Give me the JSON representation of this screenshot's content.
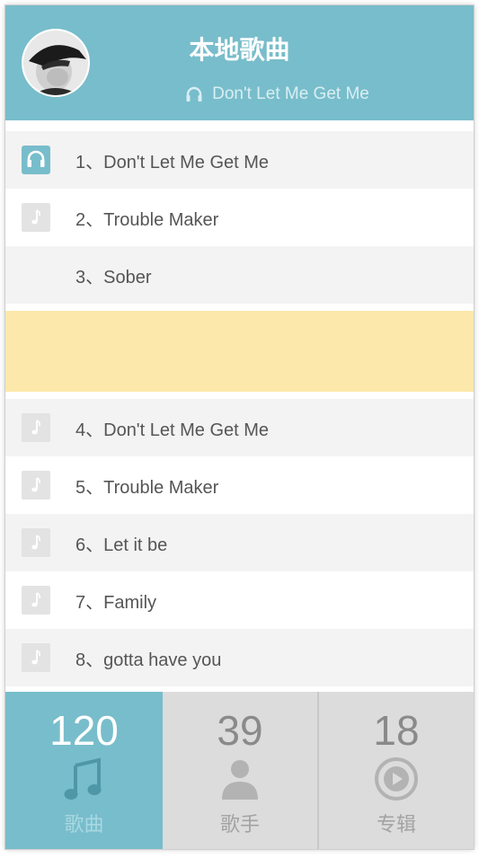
{
  "header": {
    "title": "本地歌曲",
    "now_playing": "Don't Let Me Get Me"
  },
  "songs": [
    {
      "label": "1、Don't Let Me Get Me",
      "icon": "headphones-icon",
      "state": "playing"
    },
    {
      "label": "2、Trouble Maker",
      "icon": "music-note-icon",
      "state": "normal"
    },
    {
      "label": "3、Sober",
      "icon": "none",
      "state": "normal"
    },
    {
      "label": "",
      "icon": "none",
      "state": "highlighted"
    },
    {
      "label": "4、Don't Let Me Get Me",
      "icon": "music-note-icon",
      "state": "normal"
    },
    {
      "label": "5、Trouble Maker",
      "icon": "music-note-icon",
      "state": "normal"
    },
    {
      "label": "6、Let it be",
      "icon": "music-note-icon",
      "state": "normal"
    },
    {
      "label": "7、Family",
      "icon": "music-note-icon",
      "state": "normal"
    },
    {
      "label": "8、gotta have you",
      "icon": "music-note-icon",
      "state": "normal"
    }
  ],
  "tabs": [
    {
      "count": "120",
      "label": "歌曲",
      "icon": "music-note-icon",
      "active": true
    },
    {
      "count": "39",
      "label": "歌手",
      "icon": "person-icon",
      "active": false
    },
    {
      "count": "18",
      "label": "专辑",
      "icon": "play-disc-icon",
      "active": false
    }
  ],
  "colors": {
    "accent": "#78bdcb",
    "highlight_row": "#fce8aa",
    "inactive_tab": "#dcdcdc"
  }
}
